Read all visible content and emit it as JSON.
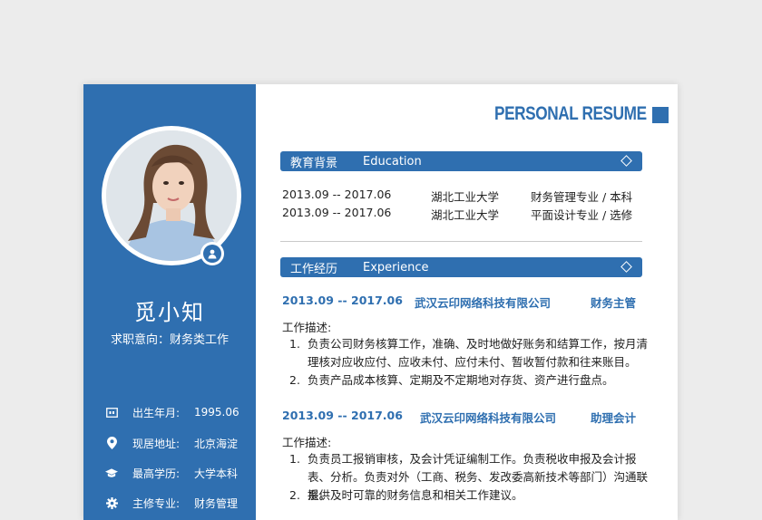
{
  "resume": {
    "title": "PERSONAL RESUME",
    "accent": "#2f6fb0"
  },
  "profile": {
    "name": "觅小知",
    "intent": "求职意向：财务类工作",
    "info": [
      {
        "icon": "calendar-icon",
        "label": "出生年月:",
        "value": "1995.06"
      },
      {
        "icon": "location-pin-icon",
        "label": "现居地址:",
        "value": "北京海淀"
      },
      {
        "icon": "graduation-cap-icon",
        "label": "最高学历:",
        "value": "大学本科"
      },
      {
        "icon": "gear-icon",
        "label": "主修专业:",
        "value": "财务管理"
      }
    ]
  },
  "education": {
    "title_cn": "教育背景",
    "title_en": "Education",
    "rows": [
      {
        "period": "2013.09 -- 2017.06",
        "school": "湖北工业大学",
        "major": "财务管理专业 / 本科"
      },
      {
        "period": "2013.09 -- 2017.06",
        "school": "湖北工业大学",
        "major": "平面设计专业 / 选修"
      }
    ]
  },
  "experience": {
    "title_cn": "工作经历",
    "title_en": "Experience",
    "jobs": [
      {
        "period": "2013.09 -- 2017.06",
        "company": "武汉云印网络科技有限公司",
        "position": "财务主管",
        "desc_label": "工作描述:",
        "items": [
          {
            "num": "1.",
            "text": "负责公司财务核算工作，准确、及时地做好账务和结算工作，按月清理核对应收应付、应收未付、应付未付、暂收暂付款和往来账目。"
          },
          {
            "num": "2.",
            "text": "负责产品成本核算、定期及不定期地对存货、资产进行盘点。"
          }
        ]
      },
      {
        "period": "2013.09 -- 2017.06",
        "company": "武汉云印网络科技有限公司",
        "position": "助理会计",
        "desc_label": "工作描述:",
        "items": [
          {
            "num": "1.",
            "text": "负责员工报销审核，及会计凭证编制工作。负责税收申报及会计报表、分析。负责对外（工商、税务、发改委高新技术等部门）沟通联系。"
          },
          {
            "num": "2.",
            "text": "提供及时可靠的财务信息和相关工作建议。"
          }
        ]
      }
    ]
  }
}
